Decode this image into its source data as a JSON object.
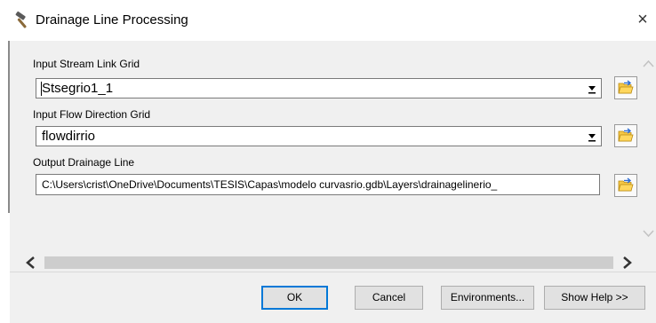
{
  "window": {
    "title": "Drainage Line Processing",
    "title_icon": "hammer-icon",
    "close_glyph": "×"
  },
  "form": {
    "stream_link": {
      "label": "Input Stream Link Grid",
      "value": "Stsegrio1_1"
    },
    "flow_direction": {
      "label": "Input Flow Direction Grid",
      "value": "flowdirrio"
    },
    "output_line": {
      "label": "Output Drainage Line",
      "value": "C:\\Users\\crist\\OneDrive\\Documents\\TESIS\\Capas\\modelo curvasrio.gdb\\Layers\\drainagelinerio_"
    }
  },
  "footer": {
    "ok_label": "OK",
    "cancel_label": "Cancel",
    "environments_label": "Environments...",
    "show_help_label": "Show Help >>"
  },
  "colors": {
    "panel": "#f0f0f0",
    "accent": "#0078d7",
    "folder_yellow": "#f6c744",
    "folder_blue": "#2a6bd4"
  }
}
